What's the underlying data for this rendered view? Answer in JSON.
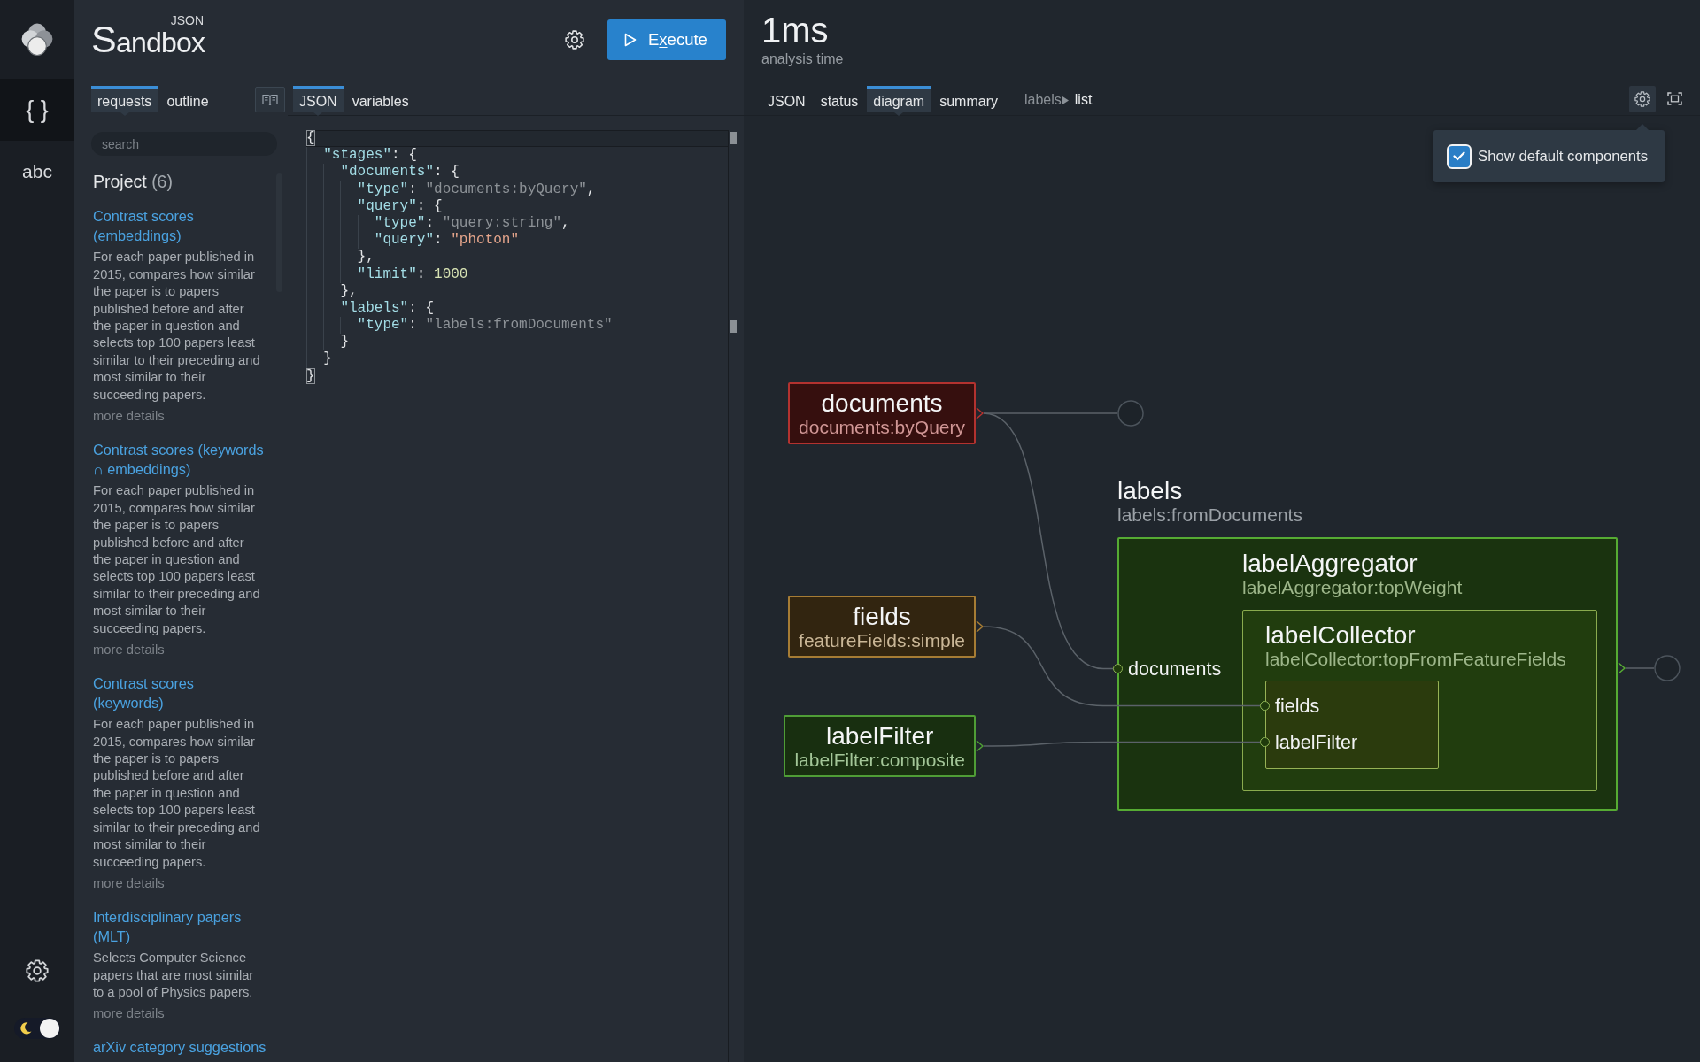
{
  "nav_rail": {
    "items": [
      {
        "label": "{ }",
        "selected": true
      },
      {
        "label": "abc",
        "selected": false
      }
    ],
    "theme_switch": {
      "on": true
    }
  },
  "header": {
    "title": "Sandbox",
    "title_superscript": "JSON",
    "execute_button": {
      "label": [
        {
          "text": "E",
          "access_key": false
        },
        {
          "text": "x",
          "access_key": true
        },
        {
          "text": "ecute",
          "access_key": false
        }
      ]
    }
  },
  "panel_tabs": [
    {
      "label": "requests",
      "selected": true
    },
    {
      "label": "outline",
      "selected": false
    }
  ],
  "editor_tabs": [
    {
      "label": "JSON",
      "selected": true
    },
    {
      "label": "variables",
      "selected": false
    }
  ],
  "requests": {
    "search": {
      "placeholder": "search"
    },
    "group": {
      "title": "Project",
      "count": "(6)"
    },
    "items": [
      {
        "title": "Contrast scores (embeddings)",
        "description": "For each paper published in 2015, compares how similar the paper is to papers published before and after the paper in question and selects top 100 papers least similar to their preceding and most similar to their succeeding papers.",
        "link": "more details"
      },
      {
        "title": "Contrast scores (keywords ∩ embeddings)",
        "description": "For each paper published in 2015, compares how similar the paper is to papers published before and after the paper in question and selects top 100 papers least similar to their preceding and most similar to their succeeding papers.",
        "link": "more details"
      },
      {
        "title": "Contrast scores (keywords)",
        "description": "For each paper published in 2015, compares how similar the paper is to papers published before and after the paper in question and selects top 100 papers least similar to their preceding and most similar to their succeeding papers.",
        "link": "more details"
      },
      {
        "title": "Interdisciplinary papers (MLT)",
        "description": "Selects Computer Science papers that are most similar to a pool of Physics papers.",
        "link": "more details"
      },
      {
        "title": "arXiv category suggestions"
      }
    ]
  },
  "editor": {
    "lines": [
      {
        "active": true,
        "tokens": [
          {
            "kind": "punct",
            "text": "{",
            "matched": true
          }
        ],
        "children": [
          {
            "active": false,
            "tokens": [
              {
                "kind": "key",
                "text": "\"stages\"",
                "matched": false
              },
              {
                "kind": "punct",
                "text": ": {",
                "matched": false
              }
            ],
            "children": [
              {
                "active": false,
                "tokens": [
                  {
                    "kind": "key",
                    "text": "\"documents\"",
                    "matched": false
                  },
                  {
                    "kind": "punct",
                    "text": ": {",
                    "matched": false
                  }
                ],
                "children": [
                  {
                    "active": false,
                    "tokens": [
                      {
                        "kind": "key",
                        "text": "\"type\"",
                        "matched": false
                      },
                      {
                        "kind": "punct",
                        "text": ": ",
                        "matched": false
                      },
                      {
                        "kind": "type",
                        "text": "\"documents:byQuery\"",
                        "matched": false
                      },
                      {
                        "kind": "punct",
                        "text": ",",
                        "matched": false
                      }
                    ]
                  },
                  {
                    "active": false,
                    "tokens": [
                      {
                        "kind": "key",
                        "text": "\"query\"",
                        "matched": false
                      },
                      {
                        "kind": "punct",
                        "text": ": {",
                        "matched": false
                      }
                    ],
                    "children": [
                      {
                        "active": false,
                        "tokens": [
                          {
                            "kind": "key",
                            "text": "\"type\"",
                            "matched": false
                          },
                          {
                            "kind": "punct",
                            "text": ": ",
                            "matched": false
                          },
                          {
                            "kind": "type",
                            "text": "\"query:string\"",
                            "matched": false
                          },
                          {
                            "kind": "punct",
                            "text": ",",
                            "matched": false
                          }
                        ]
                      },
                      {
                        "active": false,
                        "tokens": [
                          {
                            "kind": "key",
                            "text": "\"query\"",
                            "matched": false
                          },
                          {
                            "kind": "punct",
                            "text": ": ",
                            "matched": false
                          },
                          {
                            "kind": "string",
                            "text": "\"photon\"",
                            "matched": false
                          }
                        ]
                      }
                    ]
                  },
                  {
                    "active": false,
                    "tokens": [
                      {
                        "kind": "punct",
                        "text": "},",
                        "matched": false
                      }
                    ]
                  },
                  {
                    "active": false,
                    "tokens": [
                      {
                        "kind": "key",
                        "text": "\"limit\"",
                        "matched": false
                      },
                      {
                        "kind": "punct",
                        "text": ": ",
                        "matched": false
                      },
                      {
                        "kind": "number",
                        "text": "1000",
                        "matched": false
                      }
                    ]
                  }
                ]
              },
              {
                "active": false,
                "tokens": [
                  {
                    "kind": "punct",
                    "text": "},",
                    "matched": false
                  }
                ]
              },
              {
                "active": false,
                "tokens": [
                  {
                    "kind": "key",
                    "text": "\"labels\"",
                    "matched": false
                  },
                  {
                    "kind": "punct",
                    "text": ": {",
                    "matched": false
                  }
                ],
                "children": [
                  {
                    "active": false,
                    "tokens": [
                      {
                        "kind": "key",
                        "text": "\"type\"",
                        "matched": false
                      },
                      {
                        "kind": "punct",
                        "text": ": ",
                        "matched": false
                      },
                      {
                        "kind": "type",
                        "text": "\"labels:fromDocuments\"",
                        "matched": false
                      }
                    ]
                  }
                ]
              },
              {
                "active": false,
                "tokens": [
                  {
                    "kind": "punct",
                    "text": "}",
                    "matched": false
                  }
                ]
              }
            ]
          },
          {
            "active": false,
            "tokens": [
              {
                "kind": "punct",
                "text": "}",
                "matched": false
              }
            ]
          }
        ]
      },
      {
        "active": false,
        "tokens": [
          {
            "kind": "punct",
            "text": "}",
            "matched": true
          }
        ]
      }
    ]
  },
  "analysis": {
    "value": "1ms",
    "label": "analysis time"
  },
  "result_tabs": [
    {
      "label": "JSON",
      "selected": false
    },
    {
      "label": "status",
      "selected": false
    },
    {
      "label": "diagram",
      "selected": true
    },
    {
      "label": "summary",
      "selected": false
    }
  ],
  "breadcrumb": [
    {
      "label": "labels",
      "current": false
    },
    {
      "label": "list",
      "current": true
    }
  ],
  "diagram_settings": {
    "open": true,
    "options": [
      {
        "label": "Show default components",
        "checked": true
      }
    ]
  },
  "diagram": {
    "nodes": [
      {
        "kind": "stage",
        "name": "documents",
        "type": "documents:byQuery",
        "color": "#b3322f"
      },
      {
        "kind": "component",
        "name": "fields",
        "type": "featureFields:simple",
        "color": "#a67c34"
      },
      {
        "kind": "component",
        "name": "labelFilter",
        "type": "labelFilter:composite",
        "color": "#4f9d36"
      },
      {
        "kind": "composite_stage",
        "name": "labels",
        "type": "labels:fromDocuments",
        "color": "#56ab33",
        "ports": [
          "documents"
        ],
        "children": [
          {
            "name": "labelAggregator",
            "type": "labelAggregator:topWeight",
            "children": [
              {
                "name": "labelCollector",
                "type": "labelCollector:topFromFeatureFields",
                "ports": [
                  "fields",
                  "labelFilter"
                ]
              }
            ]
          }
        ]
      }
    ]
  }
}
